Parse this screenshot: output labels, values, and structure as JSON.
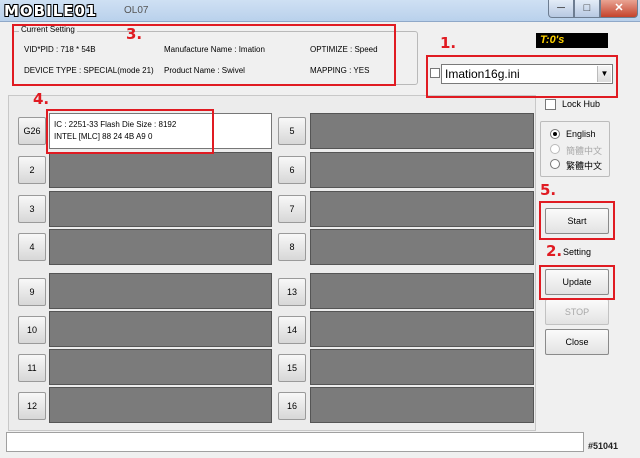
{
  "window": {
    "logo": "MOBILE01",
    "title_suffix": "OL07",
    "minimize_glyph": "─",
    "maximize_glyph": "□",
    "close_glyph": "✕"
  },
  "current_setting": {
    "legend": "Current Setting",
    "vid_pid": "VID*PID :  718 * 54B",
    "manufacture": "Manufacture Name : Imation",
    "optimize": "OPTIMIZE : Speed",
    "device_type": "DEVICE TYPE : SPECIAL(mode 21)",
    "product": "Product Name : Swivel",
    "mapping": "MAPPING : YES"
  },
  "timer": "T:0's",
  "ini_file": {
    "selected": "Imation16g.ini",
    "arrow": "▼"
  },
  "lock_hub": {
    "label": "Lock Hub",
    "checked": false
  },
  "language": {
    "options": [
      {
        "label": "English",
        "selected": true,
        "enabled": true
      },
      {
        "label": "簡體中文",
        "selected": false,
        "enabled": false
      },
      {
        "label": "繁體中文",
        "selected": false,
        "enabled": true
      }
    ]
  },
  "buttons": {
    "start": "Start",
    "setting": "Setting",
    "update": "Update",
    "stop": "STOP",
    "close": "Close"
  },
  "ports": {
    "left": [
      {
        "label": "G26",
        "active": true,
        "line1": "IC : 2251-33  Flash Die Size : 8192",
        "line2": "INTEL [MLC] 88 24 4B A9 0"
      },
      {
        "label": "2",
        "active": false
      },
      {
        "label": "3",
        "active": false
      },
      {
        "label": "4",
        "active": false
      },
      {
        "label": "9",
        "active": false
      },
      {
        "label": "10",
        "active": false
      },
      {
        "label": "11",
        "active": false
      },
      {
        "label": "12",
        "active": false
      }
    ],
    "right": [
      {
        "label": "5"
      },
      {
        "label": "6"
      },
      {
        "label": "7"
      },
      {
        "label": "8"
      },
      {
        "label": "13"
      },
      {
        "label": "14"
      },
      {
        "label": "15"
      },
      {
        "label": "16"
      }
    ]
  },
  "annotations": [
    "1.",
    "2.",
    "3.",
    "4.",
    "5."
  ],
  "watermark": "#51041",
  "colors": {
    "annotation_red": "#e01b22",
    "timer_text": "#ffd200",
    "slot_gray": "#7b7b7b"
  }
}
